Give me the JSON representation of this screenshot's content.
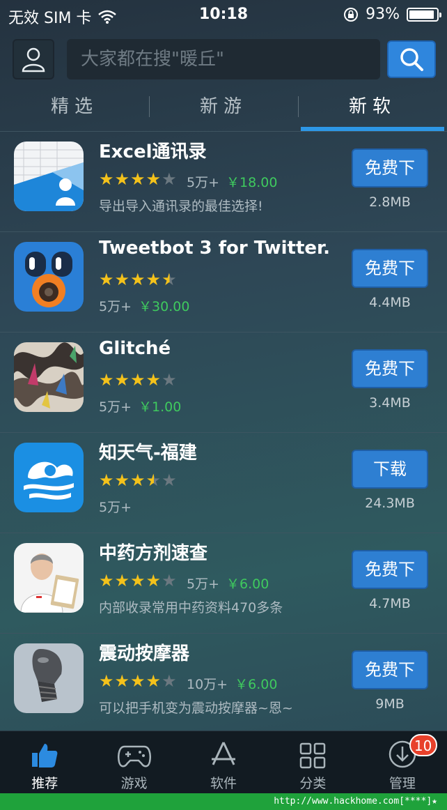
{
  "status_bar": {
    "carrier": "无效 SIM 卡",
    "time": "10:18",
    "battery": "93%",
    "battery_level": 0.93
  },
  "search": {
    "placeholder": "大家都在搜\"暖丘\""
  },
  "tabs": [
    {
      "label": "精选"
    },
    {
      "label": "新游"
    },
    {
      "label": "新软"
    }
  ],
  "active_tab": "新软",
  "apps": [
    {
      "name": "Excel通讯录",
      "rating": 4.0,
      "count": "5万+",
      "price": "￥18.00",
      "desc": "导出导入通讯录的最佳选择!",
      "button": "免费下",
      "size": "2.8MB"
    },
    {
      "name": "Tweetbot 3 for Twitter....",
      "rating": 4.5,
      "count": "5万+",
      "price": "￥30.00",
      "desc": "",
      "button": "免费下",
      "size": "4.4MB"
    },
    {
      "name": "Glitché",
      "rating": 4.0,
      "count": "5万+",
      "price": "￥1.00",
      "desc": "",
      "button": "免费下",
      "size": "3.4MB"
    },
    {
      "name": "知天气-福建",
      "rating": 3.5,
      "count": "5万+",
      "price": "",
      "desc": "",
      "button": "下载",
      "size": "24.3MB"
    },
    {
      "name": "中药方剂速查",
      "rating": 4.0,
      "count": "5万+",
      "price": "￥6.00",
      "desc": "内部收录常用中药资料470多条",
      "button": "免费下",
      "size": "4.7MB"
    },
    {
      "name": "震动按摩器",
      "rating": 4.0,
      "count": "10万+",
      "price": "￥6.00",
      "desc": "可以把手机变为震动按摩器~恩~",
      "button": "免费下",
      "size": "9MB"
    }
  ],
  "tab_bar": [
    {
      "label": "推荐",
      "icon": "thumbs-up-icon"
    },
    {
      "label": "游戏",
      "icon": "gamepad-icon"
    },
    {
      "label": "软件",
      "icon": "app-store-icon"
    },
    {
      "label": "分类",
      "icon": "grid-icon"
    },
    {
      "label": "管理",
      "icon": "download-icon",
      "badge": "10"
    }
  ],
  "footer_text": "http://www.hackhome.com[****]★",
  "colors": {
    "accent": "#2d97e6",
    "button": "#2e7fd2",
    "price": "#3fca5e",
    "star": "#f4c21b",
    "badge": "#e8412b"
  }
}
